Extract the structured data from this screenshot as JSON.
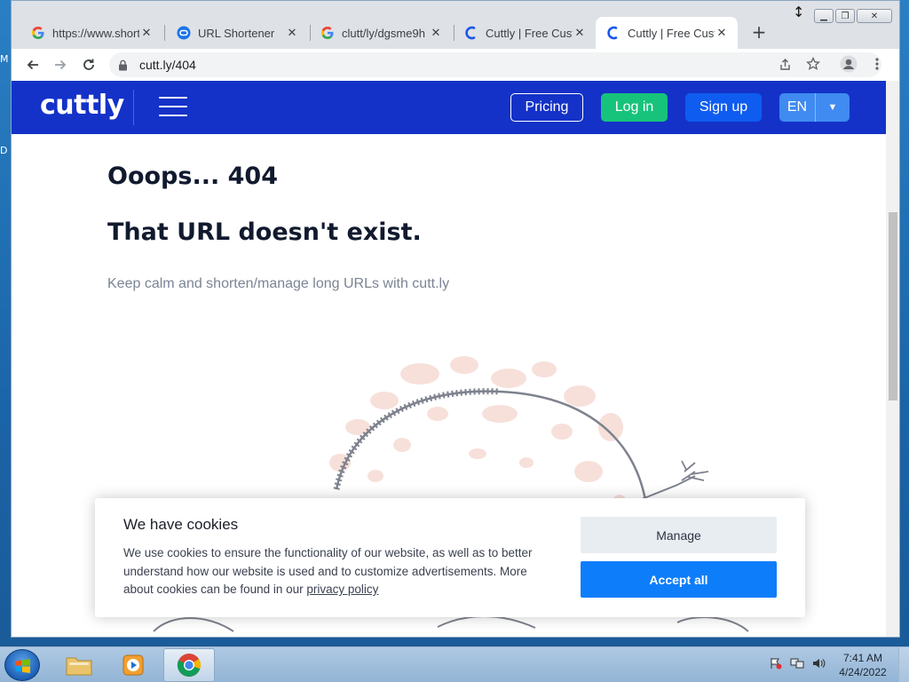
{
  "desktop": {
    "edge_labels": [
      "M",
      "D"
    ]
  },
  "tabs": [
    {
      "title": "https://www.shorte",
      "favicon": "google-g-icon",
      "active": false
    },
    {
      "title": "URL Shortener",
      "favicon": "url-shortener-icon",
      "active": false
    },
    {
      "title": "clutt/ly/dgsme9h",
      "favicon": "google-g-icon",
      "active": false
    },
    {
      "title": "Cuttly | Free Custo",
      "favicon": "cuttly-icon",
      "active": false
    },
    {
      "title": "Cuttly | Free Custo",
      "favicon": "cuttly-icon",
      "active": true
    }
  ],
  "toolbar": {
    "url": "cutt.ly/404"
  },
  "site": {
    "logo": "cuttly",
    "nav": {
      "pricing": "Pricing",
      "login": "Log in",
      "signup": "Sign up",
      "language": "EN"
    },
    "colors": {
      "header": "#1432c8",
      "login": "#17c37b",
      "signup": "#0f5cf0",
      "accept": "#0d7dfa"
    }
  },
  "error": {
    "heading": "Ooops... 404",
    "message": "That URL doesn't exist.",
    "subtext": "Keep calm and shorten/manage long URLs with cutt.ly"
  },
  "cookie": {
    "title": "We have cookies",
    "text": "We use cookies to ensure the functionality of our website, as well as to better understand how our website is used and to customize advertisements. More about cookies can be found in our ",
    "link": "privacy policy",
    "manage": "Manage",
    "accept": "Accept all"
  },
  "taskbar": {
    "time": "7:41 AM",
    "date": "4/24/2022"
  }
}
